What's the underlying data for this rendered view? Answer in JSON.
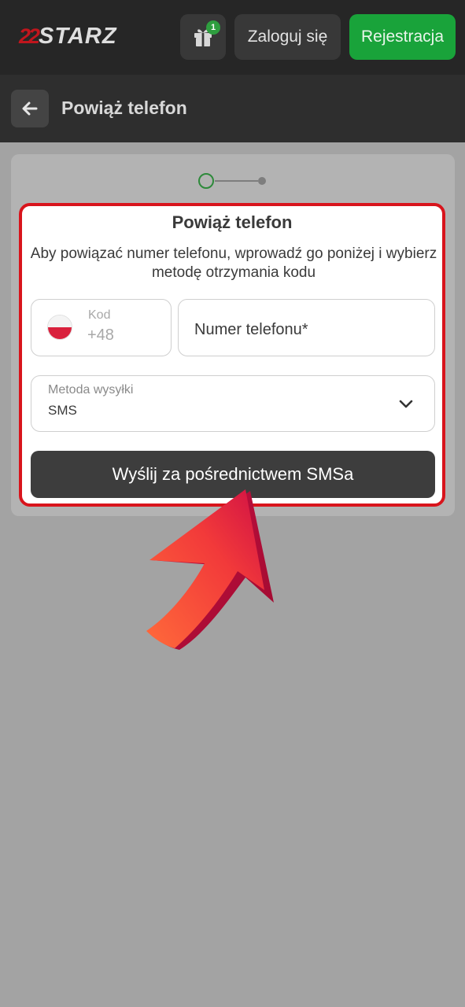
{
  "header": {
    "logo_mark": "22",
    "logo_text": "STARZ",
    "gift_badge": "1",
    "login_label": "Zaloguj się",
    "register_label": "Rejestracja"
  },
  "subheader": {
    "title": "Powiąż telefon"
  },
  "modal": {
    "title": "Powiąż telefon",
    "description": "Aby powiązać numer telefonu, wprowadź go poniżej i wybierz metodę otrzymania kodu",
    "code_label": "Kod",
    "code_value": "+48",
    "phone_placeholder": "Numer telefonu*",
    "method_label": "Metoda wysyłki",
    "method_value": "SMS",
    "send_label": "Wyślij za pośrednictwem SMSa"
  },
  "colors": {
    "accent_green": "#19a33a",
    "highlight_red": "#d8141c",
    "topbar": "#262626"
  },
  "icons": {
    "gift": "gift-icon",
    "back": "arrow-left-icon",
    "chevron": "chevron-down-icon",
    "flag": "poland-flag-icon"
  }
}
